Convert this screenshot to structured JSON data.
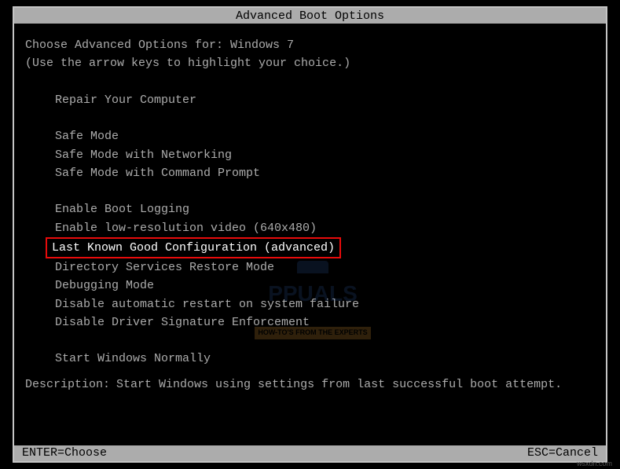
{
  "title": "Advanced Boot Options",
  "intro_line1_prefix": "Choose Advanced Options for: ",
  "intro_line1_os": "Windows 7",
  "intro_line2": "(Use the arrow keys to highlight your choice.)",
  "options": {
    "repair": "Repair Your Computer",
    "safe_mode": "Safe Mode",
    "safe_mode_net": "Safe Mode with Networking",
    "safe_mode_cmd": "Safe Mode with Command Prompt",
    "boot_logging": "Enable Boot Logging",
    "low_res": "Enable low-resolution video (640x480)",
    "last_known_good": "Last Known Good Configuration (advanced)",
    "dsrm": "Directory Services Restore Mode",
    "debugging": "Debugging Mode",
    "disable_auto_restart": "Disable automatic restart on system failure",
    "disable_sig": "Disable Driver Signature Enforcement",
    "start_normal": "Start Windows Normally"
  },
  "description_label": "Description:",
  "description_text": "Start Windows using settings from last successful boot attempt.",
  "status": {
    "enter": "ENTER=Choose",
    "esc": "ESC=Cancel"
  },
  "watermark": {
    "text": "PPUALS",
    "sub": "HOW-TO'S FROM THE EXPERTS"
  },
  "source": "wsxdn.com"
}
